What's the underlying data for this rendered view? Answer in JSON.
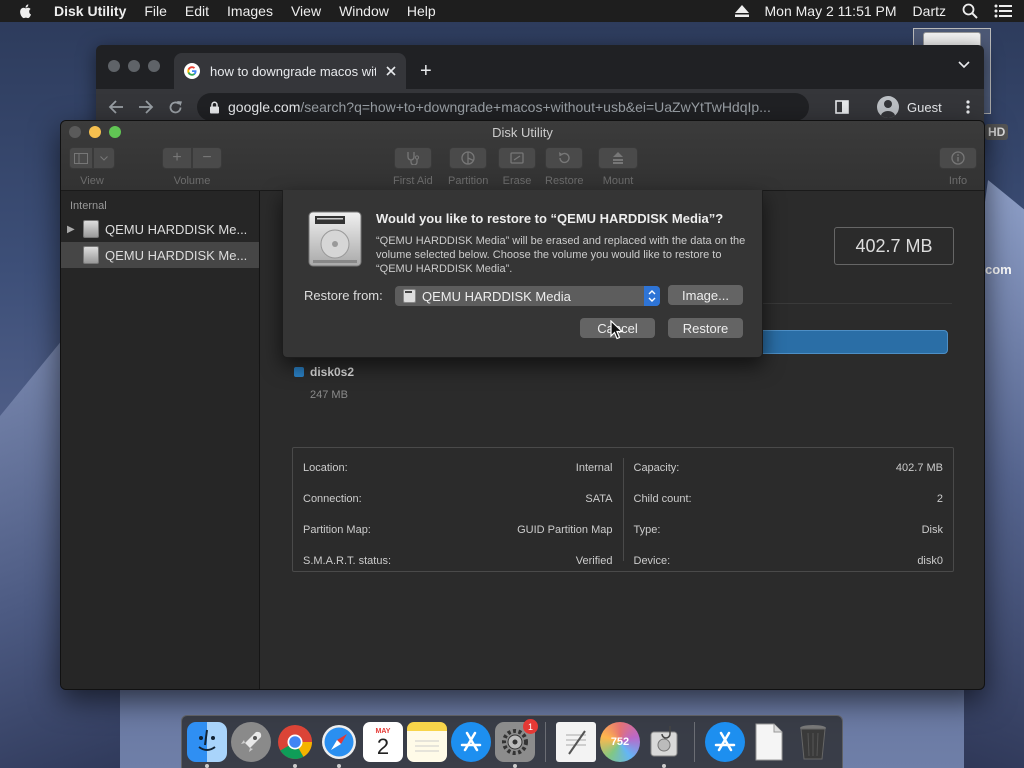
{
  "menubar": {
    "app_name": "Disk Utility",
    "items": [
      "File",
      "Edit",
      "Images",
      "View",
      "Window",
      "Help"
    ],
    "clock": "Mon May 2  11:51 PM",
    "user": "Dartz"
  },
  "desktop": {
    "drive_label": "HD",
    "partial_text": "com"
  },
  "chrome": {
    "tab_title": "how to downgrade macos with",
    "url_host": "google.com",
    "url_path": "/search?q=how+to+downgrade+macos+without+usb&ei=UaZwYtTwHdqIp...",
    "profile": "Guest"
  },
  "disk_utility": {
    "window_title": "Disk Utility",
    "toolbar": {
      "view": "View",
      "volume": "Volume",
      "first_aid": "First Aid",
      "partition": "Partition",
      "erase": "Erase",
      "restore": "Restore",
      "mount": "Mount",
      "info": "Info"
    },
    "sidebar": {
      "section": "Internal",
      "items": [
        "QEMU HARDDISK Me...",
        "QEMU HARDDISK Me..."
      ]
    },
    "capacity": "402.7 MB",
    "legend": {
      "name": "disk0s2",
      "size": "247 MB"
    },
    "info_left": [
      {
        "label": "Location:",
        "value": "Internal"
      },
      {
        "label": "Connection:",
        "value": "SATA"
      },
      {
        "label": "Partition Map:",
        "value": "GUID Partition Map"
      },
      {
        "label": "S.M.A.R.T. status:",
        "value": "Verified"
      }
    ],
    "info_right": [
      {
        "label": "Capacity:",
        "value": "402.7 MB"
      },
      {
        "label": "Child count:",
        "value": "2"
      },
      {
        "label": "Type:",
        "value": "Disk"
      },
      {
        "label": "Device:",
        "value": "disk0"
      }
    ]
  },
  "dialog": {
    "title": "Would you like to restore to “QEMU HARDDISK Media”?",
    "body": "“QEMU HARDDISK Media” will be erased and replaced with the data on the volume selected below. Choose the volume you would like to restore to “QEMU HARDDISK Media”.",
    "restore_from_label": "Restore from:",
    "restore_from_value": "QEMU HARDDISK Media",
    "image_button": "Image...",
    "cancel_button": "Cancel",
    "restore_button": "Restore"
  },
  "dock": {
    "calendar_month": "MAY",
    "calendar_day": "2",
    "settings_badge": "1",
    "circle_app_number": "752"
  }
}
